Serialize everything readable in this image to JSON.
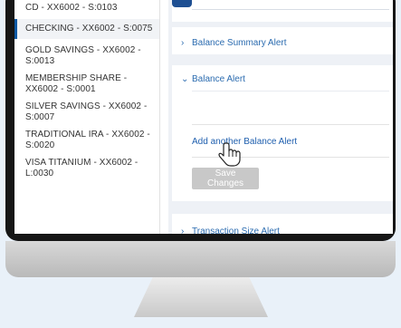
{
  "sidebar": {
    "accounts": [
      {
        "label": "CD - XX6002 - S:0103",
        "active": false
      },
      {
        "label": "CHECKING - XX6002 - S:0075",
        "active": true
      },
      {
        "label": "GOLD SAVINGS - XX6002 - S:0013",
        "active": false
      },
      {
        "label": "MEMBERSHIP SHARE - XX6002 - S:0001",
        "active": false
      },
      {
        "label": "SILVER SAVINGS - XX6002 - S:0007",
        "active": false
      },
      {
        "label": "TRADITIONAL IRA - XX6002 - S:0020",
        "active": false
      },
      {
        "label": "VISA TITANIUM - XX6002 - L:0030",
        "active": false
      }
    ]
  },
  "main": {
    "balance_summary_alert": {
      "label": "Balance Summary Alert",
      "expanded": false
    },
    "balance_alert": {
      "label": "Balance Alert",
      "expanded": true
    },
    "add_link": "Add another Balance Alert",
    "save_button": "Save Changes",
    "transaction_size_alert": {
      "label": "Transaction Size Alert",
      "expanded": false
    }
  },
  "colors": {
    "accent": "#1f5fae",
    "active_border": "#0f5aa5",
    "disabled_button": "#c8c8c8"
  }
}
